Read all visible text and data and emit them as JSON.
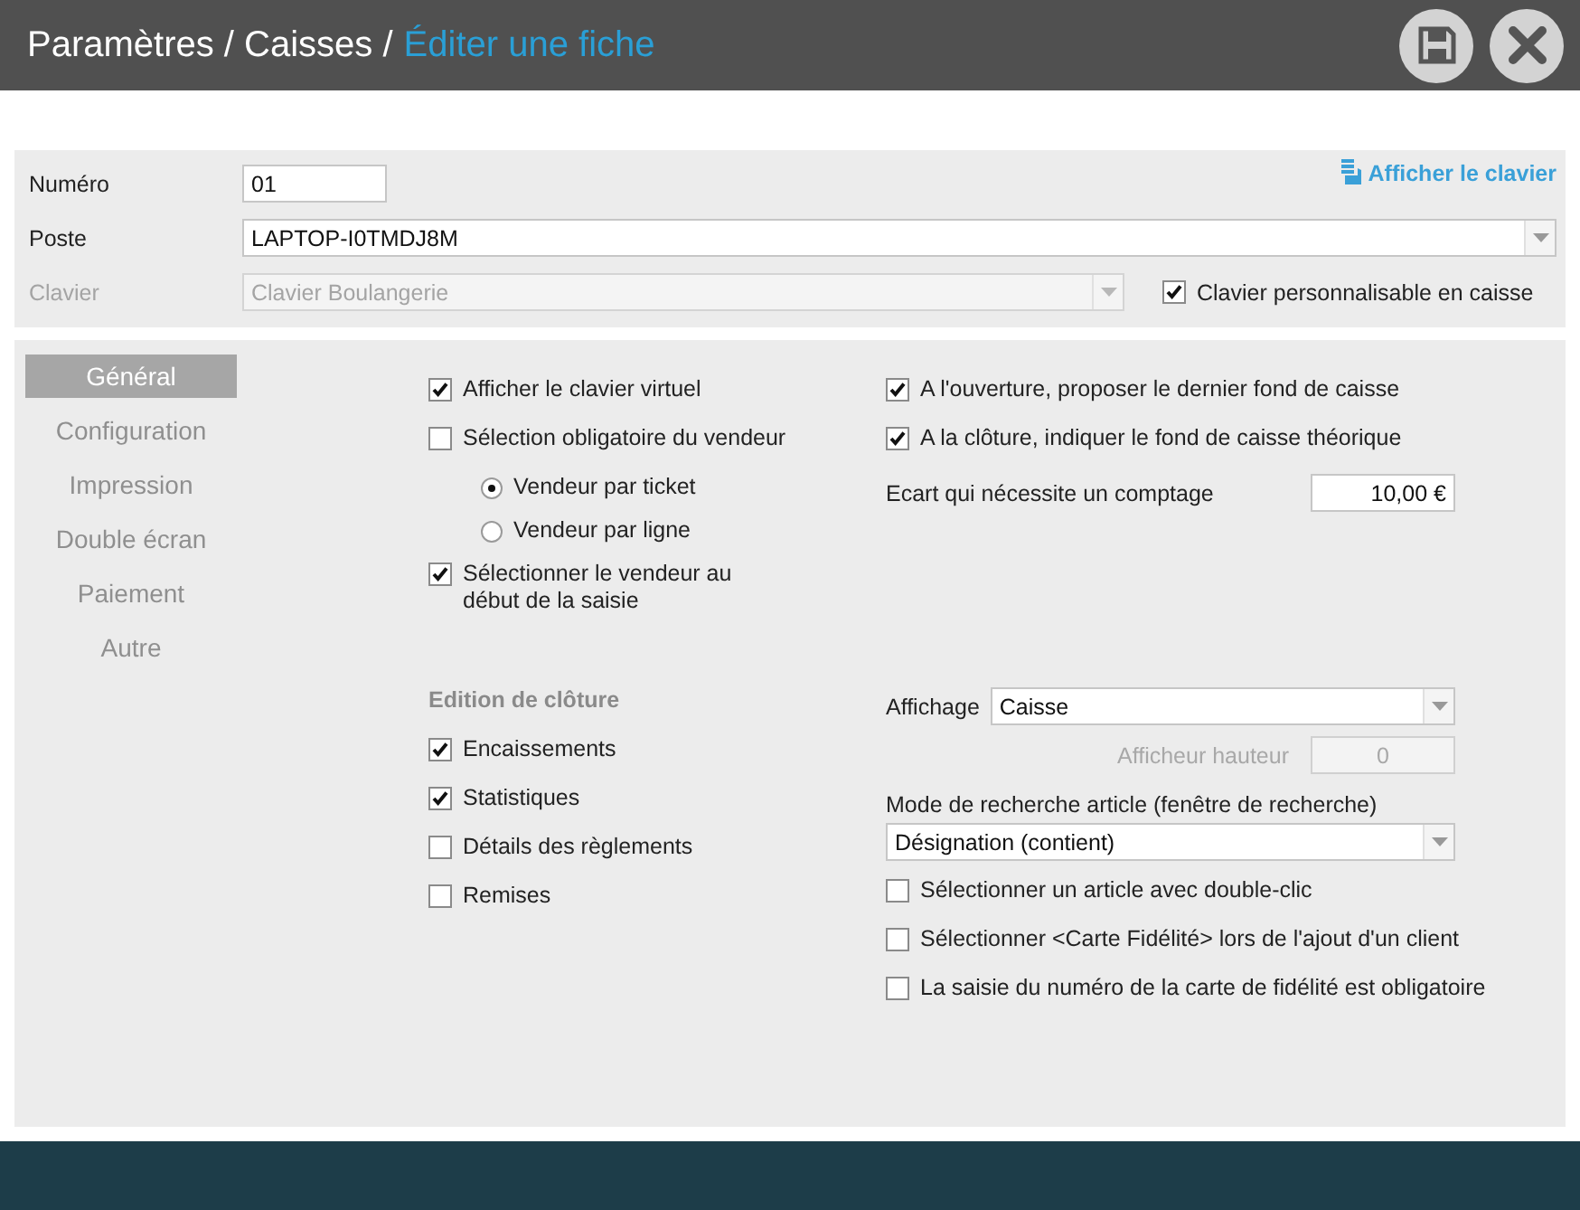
{
  "header": {
    "path": "Paramètres / Caisses /",
    "current": "Éditer une fiche"
  },
  "top_form": {
    "keyboard_link": "Afficher le clavier",
    "numero": {
      "label": "Numéro",
      "value": "01"
    },
    "poste": {
      "label": "Poste",
      "value": "LAPTOP-I0TMDJ8M",
      "disabled": false
    },
    "clavier": {
      "label": "Clavier",
      "value": "Clavier Boulangerie",
      "disabled": true
    },
    "clavier_perso": {
      "label": "Clavier personnalisable en caisse",
      "checked": true
    }
  },
  "nav": [
    {
      "label": "Général",
      "selected": true
    },
    {
      "label": "Configuration",
      "selected": false
    },
    {
      "label": "Impression",
      "selected": false
    },
    {
      "label": "Double écran",
      "selected": false
    },
    {
      "label": "Paiement",
      "selected": false
    },
    {
      "label": "Autre",
      "selected": false
    }
  ],
  "settings": {
    "left_top": [
      {
        "kind": "checkbox",
        "label": "Afficher le clavier virtuel",
        "checked": true
      },
      {
        "kind": "checkbox",
        "label": "Sélection obligatoire du vendeur",
        "checked": false
      },
      {
        "kind": "radio",
        "label": "Vendeur par ticket",
        "selected": true
      },
      {
        "kind": "radio",
        "label": "Vendeur par ligne",
        "selected": false
      },
      {
        "kind": "checkbox",
        "label": "Sélectionner le vendeur au début de la saisie",
        "checked": true
      }
    ],
    "right_top": [
      {
        "kind": "checkbox",
        "label": "A l'ouverture, proposer le dernier fond de caisse",
        "checked": true
      },
      {
        "kind": "checkbox",
        "label": "A  la clôture, indiquer le fond de caisse théorique",
        "checked": true
      },
      {
        "kind": "field",
        "label": "Ecart qui nécessite un comptage",
        "value": "10,00 €",
        "disabled": false
      }
    ],
    "left_bottom": [
      {
        "kind": "heading",
        "label": "Edition de clôture"
      },
      {
        "kind": "checkbox",
        "label": "Encaissements",
        "checked": true
      },
      {
        "kind": "checkbox",
        "label": "Statistiques",
        "checked": true
      },
      {
        "kind": "checkbox",
        "label": "Détails des règlements",
        "checked": false
      },
      {
        "kind": "checkbox",
        "label": "Remises",
        "checked": false
      }
    ],
    "right_bottom": [
      {
        "kind": "select",
        "label": "Affichage",
        "value": "Caisse",
        "disabled": false
      },
      {
        "kind": "field",
        "label": "Afficheur hauteur",
        "value": "0",
        "disabled": true
      },
      {
        "kind": "stacked-select",
        "label": "Mode de recherche article (fenêtre de recherche)",
        "value": "Désignation (contient)",
        "disabled": false
      },
      {
        "kind": "checkbox",
        "label": "Sélectionner un article avec double-clic",
        "checked": false
      },
      {
        "kind": "checkbox",
        "label": "Sélectionner <Carte Fidélité> lors de l'ajout d'un client",
        "checked": false
      },
      {
        "kind": "checkbox",
        "label": "La saisie du numéro de la carte de fidélité est obligatoire",
        "checked": false
      }
    ]
  }
}
